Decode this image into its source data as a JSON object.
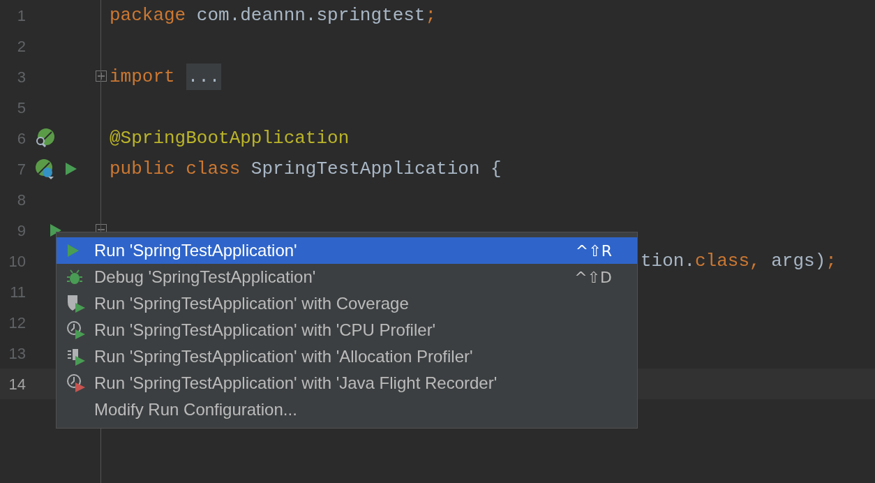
{
  "editor": {
    "lines": [
      {
        "number": "1",
        "tokens": [
          {
            "kind": "keyword",
            "text": "package"
          },
          {
            "kind": "plain",
            "text": " com.deannn.springtest"
          },
          {
            "kind": "keyword",
            "text": ";"
          }
        ]
      },
      {
        "number": "2"
      },
      {
        "number": "3",
        "fold_marker": {
          "expanded": false
        },
        "tokens": [
          {
            "kind": "keyword",
            "text": "import"
          },
          {
            "kind": "folded",
            "text": "..."
          }
        ]
      },
      {
        "number": "5"
      },
      {
        "number": "6",
        "gutter_icons": [
          {
            "kind": "bean"
          }
        ],
        "tokens": [
          {
            "kind": "annotation",
            "text": "@SpringBootApplication"
          }
        ]
      },
      {
        "number": "7",
        "gutter_icons": [
          {
            "kind": "spring"
          },
          {
            "kind": "run"
          }
        ],
        "tokens": [
          {
            "kind": "keyword",
            "text": "public class"
          },
          {
            "kind": "plain",
            "text": " SpringTestApplication {"
          }
        ]
      },
      {
        "number": "8"
      },
      {
        "number": "9",
        "gutter_icons": [
          {
            "kind": "run-left"
          }
        ],
        "fold_marker": {
          "expanded": true
        }
      },
      {
        "number": "10",
        "partly_covered": true,
        "tokens": [
          {
            "kind": "plain",
            "text": "tion."
          },
          {
            "kind": "keyword",
            "text": "class,"
          },
          {
            "kind": "plain",
            "text": " args)"
          },
          {
            "kind": "keyword",
            "text": ";"
          }
        ]
      },
      {
        "number": "11"
      },
      {
        "number": "12"
      },
      {
        "number": "13"
      },
      {
        "number": "14",
        "current": true
      }
    ]
  },
  "popup": {
    "items": [
      {
        "kind": "run",
        "label": "Run 'SpringTestApplication'",
        "shortcut": "^⇧R",
        "selected": true
      },
      {
        "kind": "debug",
        "label": "Debug 'SpringTestApplication'",
        "shortcut": "^⇧D",
        "selected": false
      },
      {
        "kind": "coverage",
        "label": "Run 'SpringTestApplication' with Coverage",
        "selected": false
      },
      {
        "kind": "cpu",
        "label": "Run 'SpringTestApplication' with 'CPU Profiler'",
        "selected": false
      },
      {
        "kind": "allocation",
        "label": "Run 'SpringTestApplication' with 'Allocation Profiler'",
        "selected": false
      },
      {
        "kind": "jfr",
        "label": "Run 'SpringTestApplication' with 'Java Flight Recorder'",
        "selected": false
      },
      {
        "kind": "none",
        "label": "Modify Run Configuration...",
        "selected": false
      }
    ]
  }
}
